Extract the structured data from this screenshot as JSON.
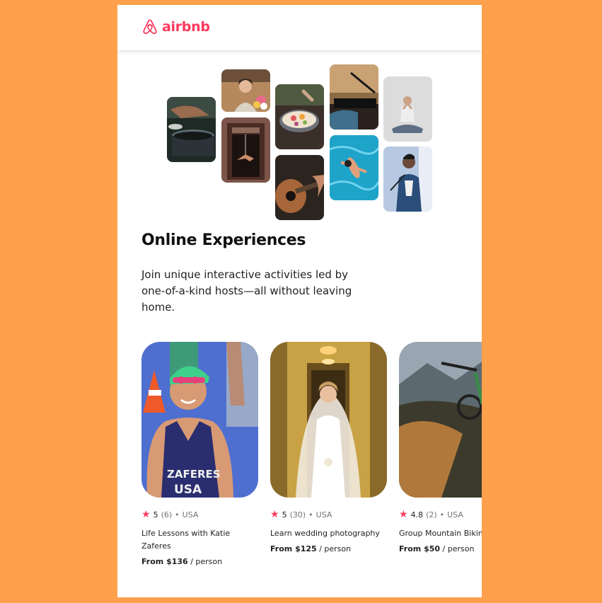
{
  "brand": {
    "name": "airbnb",
    "color": "#ff385c"
  },
  "hero": {
    "title": "Online Experiences",
    "description": "Join unique interactive activities led by one-of-a-kind hosts—all without leaving home."
  },
  "collage_images": [
    "cooking-pots",
    "woman-with-flowers",
    "aerial-performer-doorway",
    "cooking-bowl",
    "guitar-player",
    "musician-microphone",
    "swimmer-pool",
    "yoga-meditation",
    "singer-guitar"
  ],
  "experiences": [
    {
      "image": "swimmer-portrait",
      "rating": "5",
      "reviews": "(6)",
      "separator": "•",
      "country": "USA",
      "title": "Life Lessons with Katie Zaferes",
      "price_label": "From $136",
      "price_unit": " / person"
    },
    {
      "image": "bride-portrait",
      "rating": "5",
      "reviews": "(30)",
      "separator": "•",
      "country": "USA",
      "title": "Learn wedding photography",
      "price_label": "From $125",
      "price_unit": " / person"
    },
    {
      "image": "mountain-bike",
      "rating": "4.8",
      "reviews": "(2)",
      "separator": "•",
      "country": "USA",
      "title": "Group Mountain Biking",
      "price_label": "From $50",
      "price_unit": " / person"
    }
  ],
  "icons": {
    "star": "★"
  }
}
